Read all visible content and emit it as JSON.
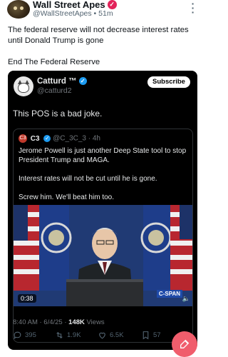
{
  "post": {
    "author_name": "Wall Street Apes",
    "author_meta": "@WallStreetApes • 51m",
    "text_line1": "The federal reserve will not decrease interest rates until Donald Trump is gone",
    "text_line2": "End The Federal Reserve"
  },
  "embed": {
    "author_name": "Catturd ™",
    "handle": "@catturd2",
    "subscribe_label": "Subscribe",
    "text": "This POS is a bad joke.",
    "meta_time": "8:40 AM · 6/4/25 · ",
    "meta_views_count": "148K",
    "meta_views_label": " Views"
  },
  "quote": {
    "avatar_label": "C3",
    "author_name": "C3",
    "rest": "@C_3C_3 · 4h",
    "para1": "Jerome Powell is just another Deep State tool to stop President Trump and MAGA.",
    "para2": "Interest rates will not be cut until he is gone.",
    "para3": "Screw him. We'll beat him too.",
    "video_duration": "0:38",
    "video_logo": "C-SPAN",
    "volume_icon": "🔈"
  },
  "actions": {
    "replies": "395",
    "reposts": "1.9K",
    "likes": "6.5K",
    "bookmarks": "57"
  },
  "colors": {
    "accent": "#1d9bf0",
    "fab": "#f05d6c",
    "badge": "#e3245b"
  }
}
